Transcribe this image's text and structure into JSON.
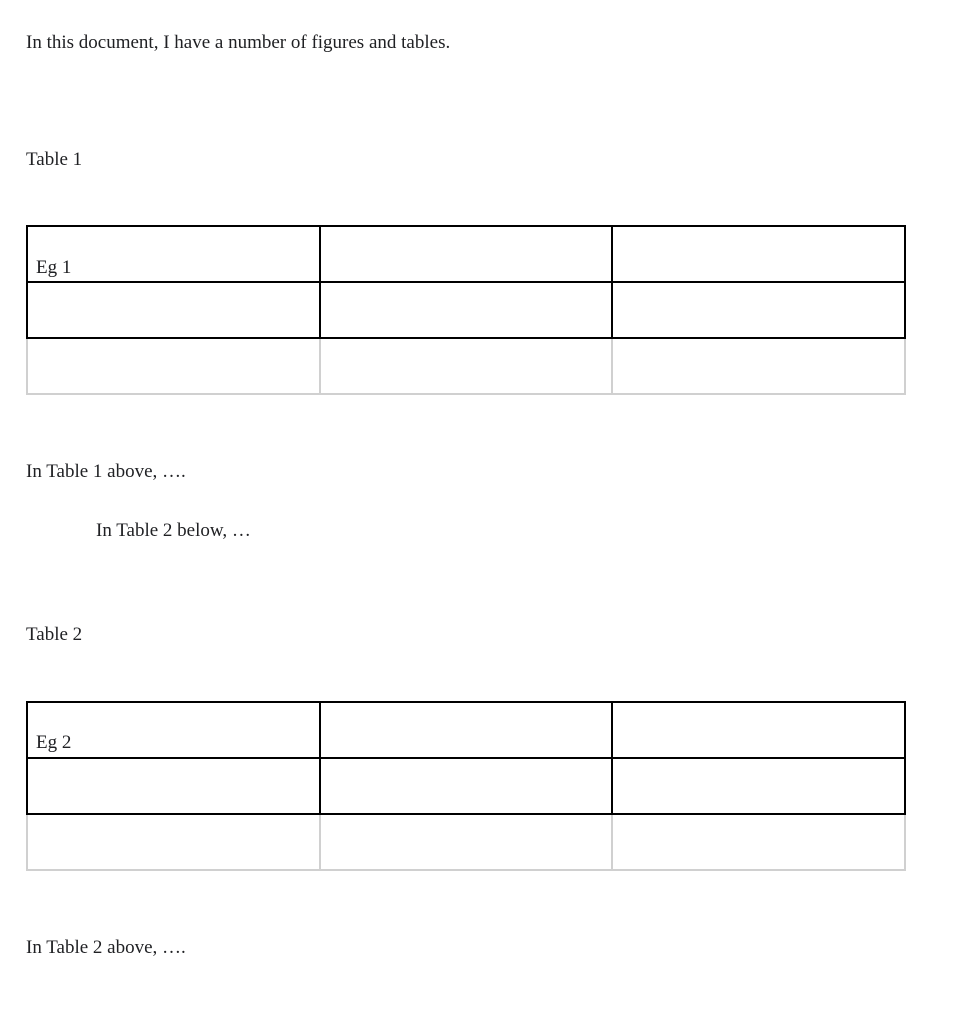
{
  "intro_text": "In this document, I have a number of figures and tables.",
  "table1": {
    "caption": "Table 1",
    "rows": [
      [
        "Eg 1",
        "",
        ""
      ],
      [
        "",
        "",
        ""
      ],
      [
        "",
        "",
        ""
      ]
    ]
  },
  "para_table1_above": "In Table 1 above, ….",
  "para_table2_below": "In Table 2 below, …",
  "table2": {
    "caption": "Table 2",
    "rows": [
      [
        "Eg 2",
        "",
        ""
      ],
      [
        "",
        "",
        ""
      ],
      [
        "",
        "",
        ""
      ]
    ]
  },
  "para_table2_above": "In Table 2 above, …."
}
